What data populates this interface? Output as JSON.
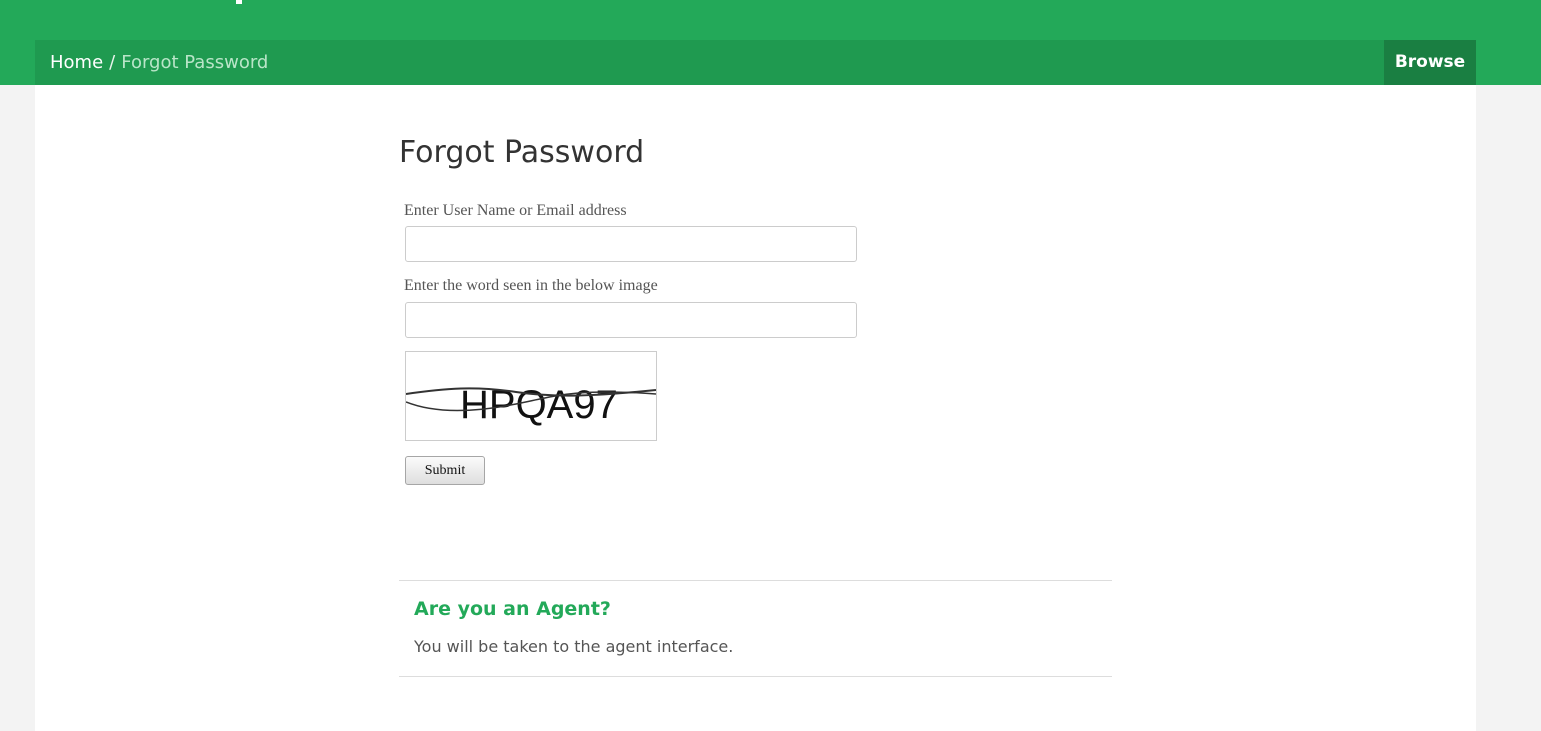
{
  "header": {
    "breadcrumb": {
      "home": "Home",
      "separator": "/",
      "current": "Forgot Password"
    },
    "browse_label": "Browse"
  },
  "form": {
    "title": "Forgot Password",
    "username_label": "Enter User Name or Email address",
    "username_value": "",
    "captcha_label": "Enter the word seen in the below image",
    "captcha_value": "",
    "captcha_text": "HPQA97",
    "submit_label": "Submit"
  },
  "agent": {
    "heading": "Are you an Agent?",
    "text": "You will be taken to the agent interface."
  },
  "colors": {
    "brand_green": "#23a959",
    "breadcrumb_bar": "#1f9a50",
    "browse_button": "#1a7f42",
    "page_background": "#f3f3f3"
  }
}
